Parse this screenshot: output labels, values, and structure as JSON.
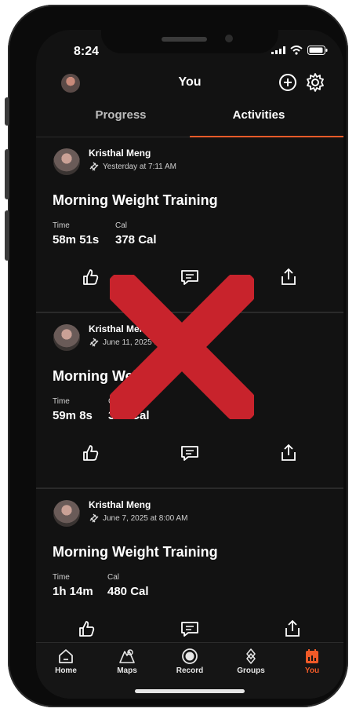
{
  "status": {
    "time": "8:24"
  },
  "header": {
    "title": "You"
  },
  "tabs": [
    {
      "label": "Progress",
      "active": false
    },
    {
      "label": "Activities",
      "active": true
    }
  ],
  "feed": [
    {
      "name": "Kristhal Meng",
      "when": "Yesterday at 7:11 AM",
      "activity": "Morning Weight Training",
      "stat1_label": "Time",
      "stat1_value": "58m 51s",
      "stat2_label": "Cal",
      "stat2_value": "378 Cal"
    },
    {
      "name": "Kristhal Meng",
      "when": "June 11, 2025 a",
      "activity": "Morning Weig",
      "stat1_label": "Time",
      "stat1_value": "59m 8s",
      "stat2_label": "Cal",
      "stat2_value": "341 Cal"
    },
    {
      "name": "Kristhal Meng",
      "when": "June 7, 2025 at 8:00 AM",
      "activity": "Morning Weight Training",
      "stat1_label": "Time",
      "stat1_value": "1h 14m",
      "stat2_label": "Cal",
      "stat2_value": "480 Cal"
    }
  ],
  "tabbar": {
    "home": "Home",
    "maps": "Maps",
    "record": "Record",
    "groups": "Groups",
    "you": "You"
  },
  "colors": {
    "accent": "#f05a28",
    "overlay_x": "#c8232c",
    "background": "#121212"
  },
  "icons": [
    "plus-circle-icon",
    "gear-icon",
    "dumbbell-icon",
    "thumbs-up-icon",
    "comment-icon",
    "share-icon",
    "home-icon",
    "maps-icon",
    "record-icon",
    "groups-icon",
    "you-calendar-icon",
    "red-x-overlay"
  ]
}
